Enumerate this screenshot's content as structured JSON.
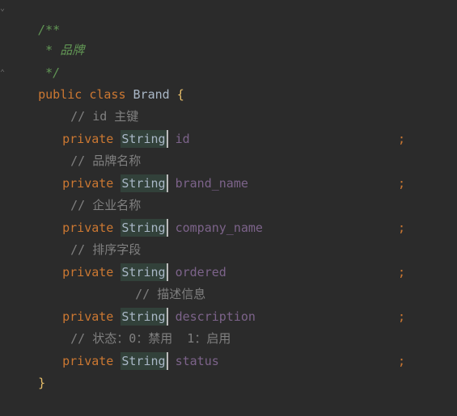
{
  "code": {
    "doc_open": "/**",
    "doc_body": " * 品牌",
    "doc_close": " */",
    "class_kw_public": "public",
    "class_kw_class": "class",
    "class_name": "Brand",
    "open_brace": "{",
    "close_brace": "}",
    "type_name": "String",
    "modifier": "private",
    "semicolon": ";",
    "fields": [
      {
        "comment": "// id 主键",
        "name": "id"
      },
      {
        "comment": "// 品牌名称",
        "name": "brand_name"
      },
      {
        "comment": "// 企业名称",
        "name": "company_name"
      },
      {
        "comment": "// 排序字段",
        "name": "ordered"
      },
      {
        "comment": "// 描述信息",
        "name": "description"
      },
      {
        "comment": "// 状态：0：禁用  1：启用",
        "name": "status"
      }
    ]
  },
  "colors": {
    "background": "#2b2b2b",
    "keyword": "#cc7832",
    "doc_comment": "#629755",
    "comment": "#808080",
    "field": "#9876aa",
    "type_highlight": "#32413a"
  }
}
